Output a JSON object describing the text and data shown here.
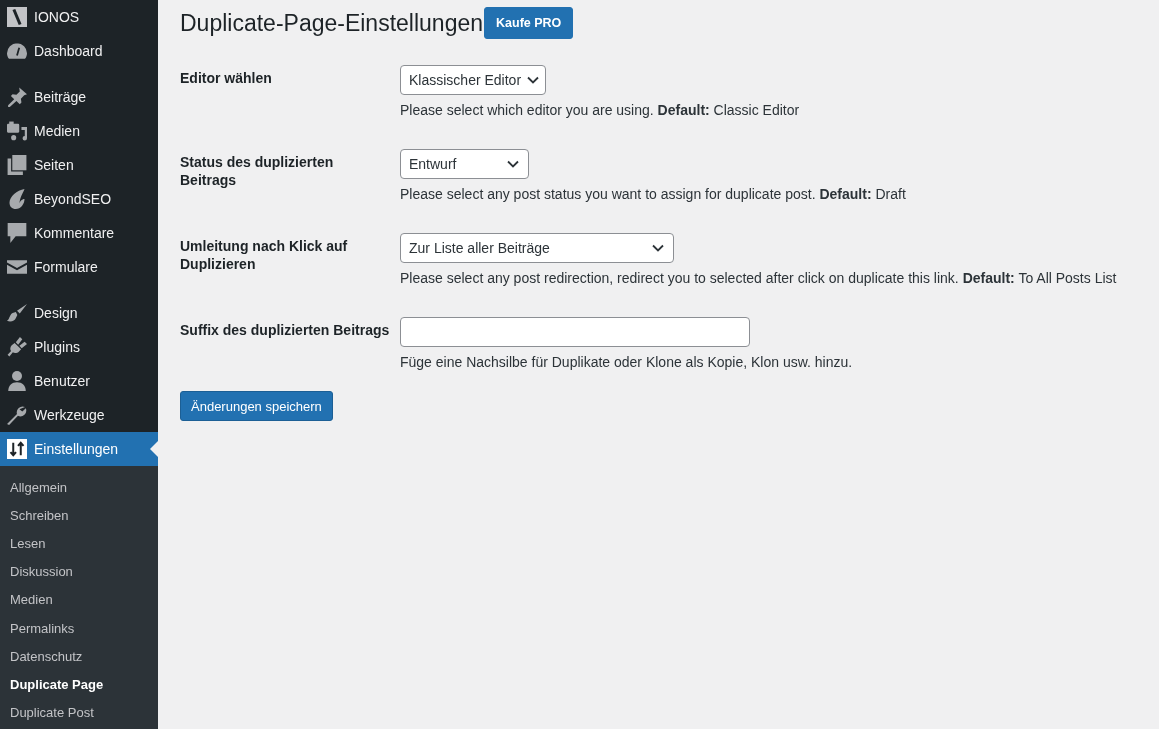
{
  "sidebar": {
    "groups": [
      {
        "items": [
          {
            "label": "IONOS",
            "selected": false
          },
          {
            "label": "Dashboard",
            "selected": false
          }
        ]
      },
      {
        "items": [
          {
            "label": "Beiträge",
            "selected": false
          },
          {
            "label": "Medien",
            "selected": false
          },
          {
            "label": "Seiten",
            "selected": false
          },
          {
            "label": "BeyondSEO",
            "selected": false
          },
          {
            "label": "Kommentare",
            "selected": false
          },
          {
            "label": "Formulare",
            "selected": false
          }
        ]
      },
      {
        "items": [
          {
            "label": "Design",
            "selected": false
          },
          {
            "label": "Plugins",
            "selected": false
          },
          {
            "label": "Benutzer",
            "selected": false
          },
          {
            "label": "Werkzeuge",
            "selected": false
          },
          {
            "label": "Einstellungen",
            "selected": true,
            "children": [
              {
                "label": "Allgemein",
                "selected": false
              },
              {
                "label": "Schreiben",
                "selected": false
              },
              {
                "label": "Lesen",
                "selected": false
              },
              {
                "label": "Diskussion",
                "selected": false
              },
              {
                "label": "Medien",
                "selected": false
              },
              {
                "label": "Permalinks",
                "selected": false
              },
              {
                "label": "Datenschutz",
                "selected": false
              },
              {
                "label": "Duplicate Page",
                "selected": true
              },
              {
                "label": "Duplicate Post",
                "selected": false
              }
            ]
          }
        ]
      }
    ]
  },
  "page": {
    "title": "Duplicate-Page-Einstellungen",
    "pro_button": "Kaufe PRO"
  },
  "settings": [
    {
      "label": "Editor wählen",
      "kind": "select",
      "value": "Klassischer Editor",
      "description": "Please select which editor you are using. **Default:** Classic Editor"
    },
    {
      "label": "Status des duplizierten Beitrags",
      "kind": "select",
      "value": "Entwurf",
      "description": "Please select any post status you want to assign for duplicate post. **Default:** Draft"
    },
    {
      "label": "Umleitung nach Klick auf Duplizieren",
      "kind": "select",
      "value": "Zur Liste aller Beiträge",
      "description": "Please select any post redirection, redirect you to selected after click on duplicate this link. **Default:** To All Posts List"
    },
    {
      "label": "Suffix des duplizierten Beitrags",
      "kind": "text",
      "description": "Füge eine Nachsilbe für Duplikate oder Klone als Kopie, Klon usw. hinzu."
    }
  ],
  "save_button": "Änderungen speichern"
}
